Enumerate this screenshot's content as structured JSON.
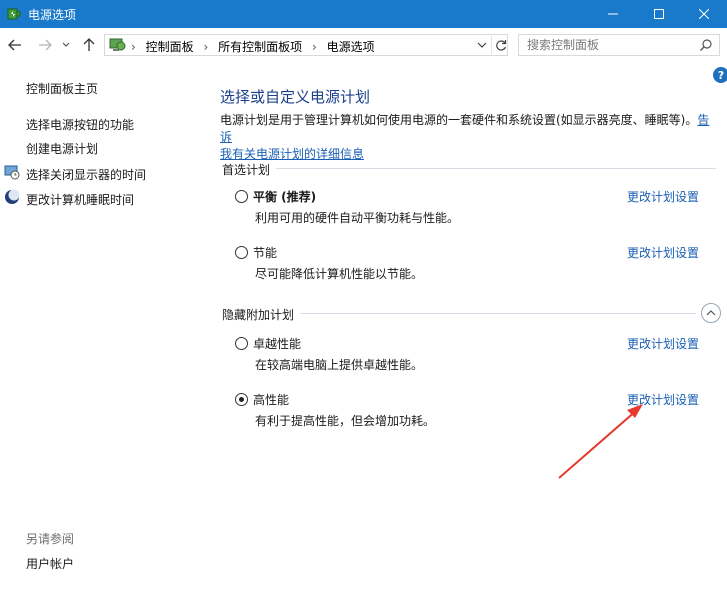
{
  "window": {
    "title": "电源选项"
  },
  "nav": {
    "breadcrumbs": [
      "控制面板",
      "所有控制面板项",
      "电源选项"
    ],
    "search_placeholder": "搜索控制面板"
  },
  "sidebar": {
    "items": [
      {
        "label": "控制面板主页"
      },
      {
        "label": "选择电源按钮的功能"
      },
      {
        "label": "创建电源计划"
      },
      {
        "label": "选择关闭显示器的时间"
      },
      {
        "label": "更改计算机睡眠时间"
      }
    ],
    "see_also": {
      "heading": "另请参阅",
      "items": [
        {
          "label": "用户帐户"
        }
      ]
    }
  },
  "main": {
    "title": "选择或自定义电源计划",
    "description": "电源计划是用于管理计算机如何使用电源的一套硬件和系统设置(如显示器亮度、睡眠等)。",
    "description_link": "告诉我有关电源计划的详细信息",
    "description_link_part1": "告诉",
    "description_link_part2": "我有关电源计划的详细信息",
    "preferred_heading": "首选计划",
    "hidden_heading": "隐藏附加计划",
    "plans": [
      {
        "name": "平衡 (推荐)",
        "description": "利用可用的硬件自动平衡功耗与性能。",
        "link": "更改计划设置",
        "selected": false
      },
      {
        "name": "节能",
        "description": "尽可能降低计算机性能以节能。",
        "link": "更改计划设置",
        "selected": false
      },
      {
        "name": "卓越性能",
        "description": "在较高端电脑上提供卓越性能。",
        "link": "更改计划设置",
        "selected": false
      },
      {
        "name": "高性能",
        "description": "有利于提高性能，但会增加功耗。",
        "link": "更改计划设置",
        "selected": true
      }
    ]
  },
  "colors": {
    "titlebar": "#1979ca",
    "link": "#1a5fb4",
    "heading": "#1b3f8b",
    "annotation_arrow": "#e53b2f"
  }
}
